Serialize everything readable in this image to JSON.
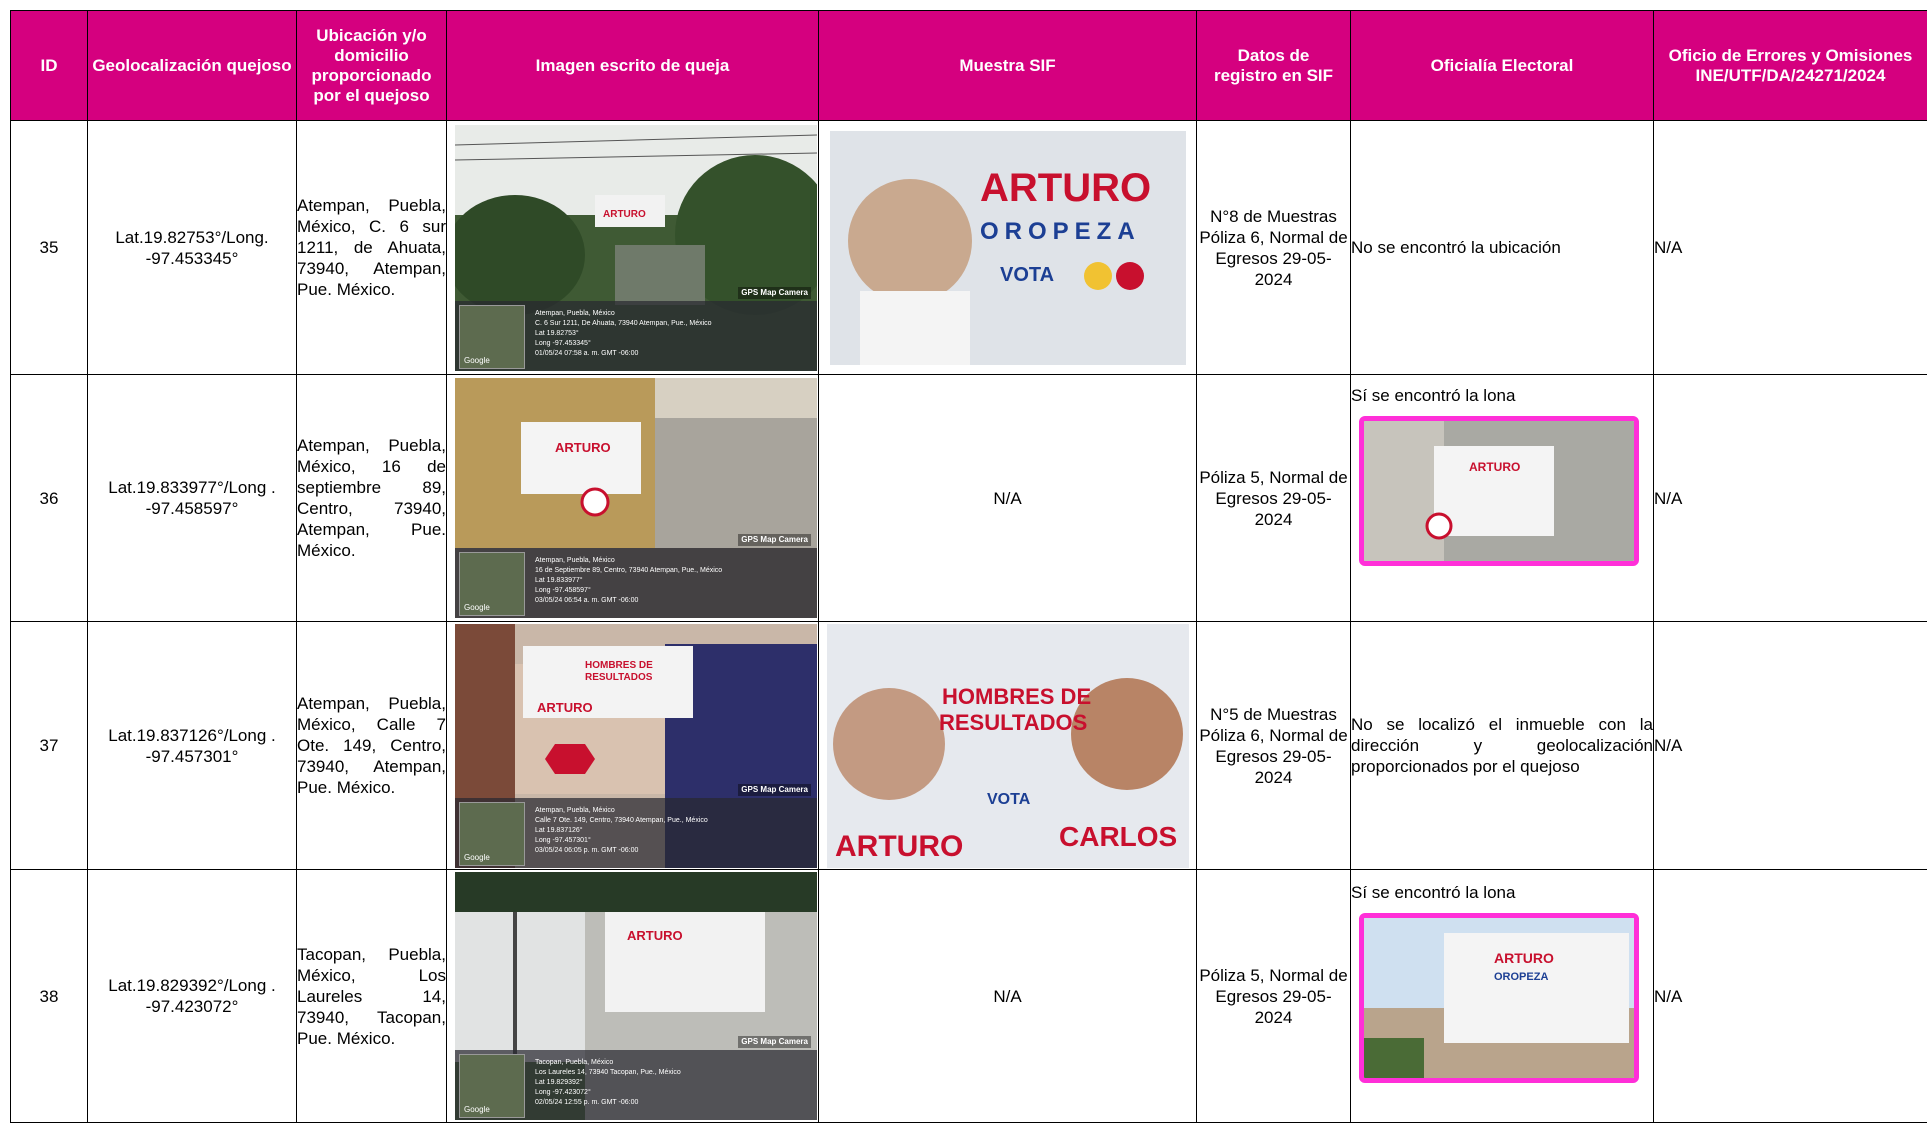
{
  "headers": {
    "id": "ID",
    "geo": "Geolocalización quejoso",
    "address": "Ubicación y/o domicilio proporcionado por el quejoso",
    "complaint_image": "Imagen escrito de queja",
    "sif_sample": "Muestra SIF",
    "sif_data": "Datos de registro en SIF",
    "oficialia": "Oficialía Electoral",
    "errors": "Oficio de Errores y Omisiones INE/UTF/DA/24271/2024"
  },
  "rows": [
    {
      "id": "35",
      "geo": "Lat.19.82753°/Long. -97.453345°",
      "address": "Atempan, Puebla, México, C. 6 sur 1211, de Ahuata, 73940, Atempan, Pue. México.",
      "photo": {
        "tag": "GPS Map Camera",
        "l1": "Atempan, Puebla, México",
        "l2": "C. 6 Sur 1211, De Ahuata, 73940 Atempan, Pue., México",
        "l3": "Lat 19.82753°",
        "l4": "Long -97.453345°",
        "l5": "01/05/24 07:58 a. m. GMT -06:00",
        "map": "Google"
      },
      "sif": "",
      "sif_banner": {
        "name": "ARTURO",
        "surname": "OROPEZA",
        "vote": "VOTA"
      },
      "data": "N°8 de Muestras Póliza 6, Normal de Egresos 29-05-2024",
      "oficialia": "No se encontró la ubicación",
      "errors": "N/A"
    },
    {
      "id": "36",
      "geo": "Lat.19.833977°/Long . -97.458597°",
      "address": "Atempan, Puebla, México, 16 de septiembre 89, Centro, 73940, Atempan, Pue. México.",
      "photo": {
        "tag": "GPS Map Camera",
        "l1": "Atempan, Puebla, México",
        "l2": "16 de Septiembre 89, Centro, 73940 Atempan, Pue., México",
        "l3": "Lat 19.833977°",
        "l4": "Long -97.458597°",
        "l5": "03/05/24 06:54 a. m. GMT -06:00",
        "map": "Google"
      },
      "sif": "N/A",
      "data": "Póliza 5, Normal de Egresos 29-05-2024",
      "oficialia": "Sí se encontró la lona",
      "errors": "N/A"
    },
    {
      "id": "37",
      "geo": "Lat.19.837126°/Long . -97.457301°",
      "address": "Atempan, Puebla, México, Calle 7 Ote. 149, Centro, 73940, Atempan, Pue. México.",
      "photo": {
        "tag": "GPS Map Camera",
        "l1": "Atempan, Puebla, México",
        "l2": "Calle 7 Ote. 149, Centro, 73940 Atempan, Pue., México",
        "l3": "Lat 19.837126°",
        "l4": "Long -97.457301°",
        "l5": "03/05/24 06:05 p. m. GMT -06:00",
        "map": "Google"
      },
      "sif": "",
      "sif_banner": {
        "title1": "HOMBRES DE",
        "title2": "RESULTADOS",
        "vote": "VOTA",
        "left": "ARTURO",
        "right": "CARLOS"
      },
      "data": "N°5 de Muestras Póliza 6, Normal de Egresos 29-05-2024",
      "oficialia": "No se localizó el inmueble con la dirección y geolocalización proporcionados por el quejoso",
      "errors": "N/A"
    },
    {
      "id": "38",
      "geo": "Lat.19.829392°/Long . -97.423072°",
      "address": "Tacopan, Puebla, México, Los Laureles 14, 73940, Tacopan, Pue. México.",
      "photo": {
        "tag": "GPS Map Camera",
        "l1": "Tacopan, Puebla, México",
        "l2": "Los Laureles 14, 73940 Tacopan, Pue., México",
        "l3": "Lat 19.829392°",
        "l4": "Long -97.423072°",
        "l5": "02/05/24 12:55 p. m. GMT -06:00",
        "map": "Google"
      },
      "sif": "N/A",
      "data": "Póliza 5, Normal de Egresos 29-05-2024",
      "oficialia": "Sí se encontró la lona",
      "errors": "N/A"
    }
  ],
  "colors": {
    "header_bg": "#d5007f",
    "header_text": "#ffffff",
    "frame": "#ff2fd8",
    "brand_red": "#c8102e",
    "brand_blue": "#1c3f94"
  }
}
